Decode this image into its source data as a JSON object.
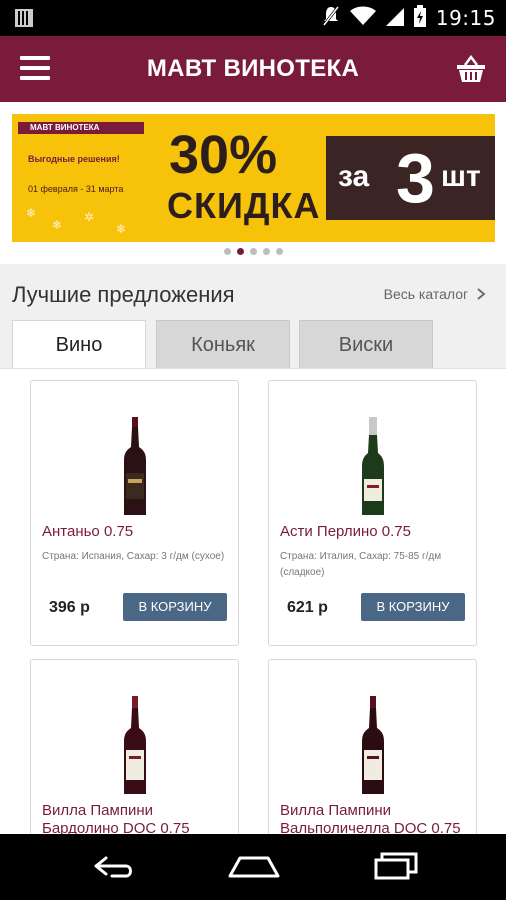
{
  "status_bar": {
    "time": "19:15"
  },
  "app_bar": {
    "title": "МАВТ ВИНОТЕКА"
  },
  "banner": {
    "brand": "МАВТ ВИНОТЕКА",
    "tagline": "Выгодные решения!",
    "dates": "01 февраля - 31 марта",
    "discount": "30%",
    "discount_word": "СКИДКА",
    "offer_prefix": "за",
    "offer_number": "3",
    "offer_suffix": "шт",
    "colors": {
      "background": "#f7c20a",
      "dark": "#3b2424",
      "brand": "#7a1b3c"
    },
    "dots_count": 5,
    "active_dot": 2
  },
  "section": {
    "title": "Лучшие предложения",
    "link": "Весь каталог"
  },
  "tabs": [
    {
      "label": "Вино",
      "active": true
    },
    {
      "label": "Коньяк",
      "active": false
    },
    {
      "label": "Виски",
      "active": false
    }
  ],
  "products": [
    {
      "name": "Антаньо 0.75",
      "meta": "Страна: Испания, Сахар: 3 г/дм (сухое)",
      "price": "396 р",
      "button": "В КОРЗИНУ",
      "bottle": "red"
    },
    {
      "name": "Асти Перлино 0.75",
      "meta": "Страна: Италия, Сахар: 75-85 г/дм (сладкое)",
      "price": "621 р",
      "button": "В КОРЗИНУ",
      "bottle": "sparkling"
    },
    {
      "name": "Вилла Пампини Бардолино DOC 0.75",
      "meta": "",
      "price": "",
      "button": "",
      "bottle": "red"
    },
    {
      "name": "Вилла Пампини Вальполичелла DOC 0.75",
      "meta": "",
      "price": "",
      "button": "",
      "bottle": "red"
    }
  ],
  "colors": {
    "accent": "#7a1b3c",
    "button": "#4a6786"
  }
}
